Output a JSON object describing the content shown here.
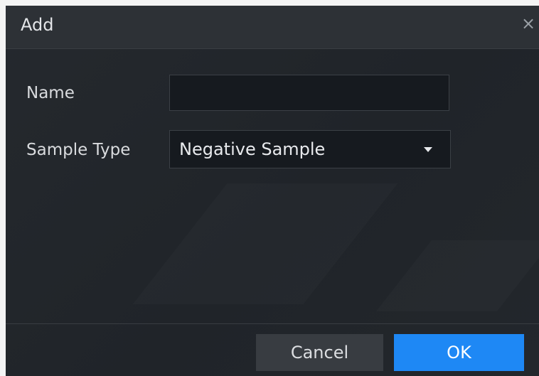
{
  "dialog": {
    "title": "Add",
    "close_icon": "close-icon",
    "colors": {
      "background": "#202429",
      "accent": "#1e88f5"
    }
  },
  "form": {
    "name": {
      "label": "Name",
      "value": "",
      "placeholder": ""
    },
    "sample_type": {
      "label": "Sample Type",
      "value": "Negative Sample",
      "icon": "caret-down-icon"
    }
  },
  "buttons": {
    "cancel_label": "Cancel",
    "ok_label": "OK"
  }
}
